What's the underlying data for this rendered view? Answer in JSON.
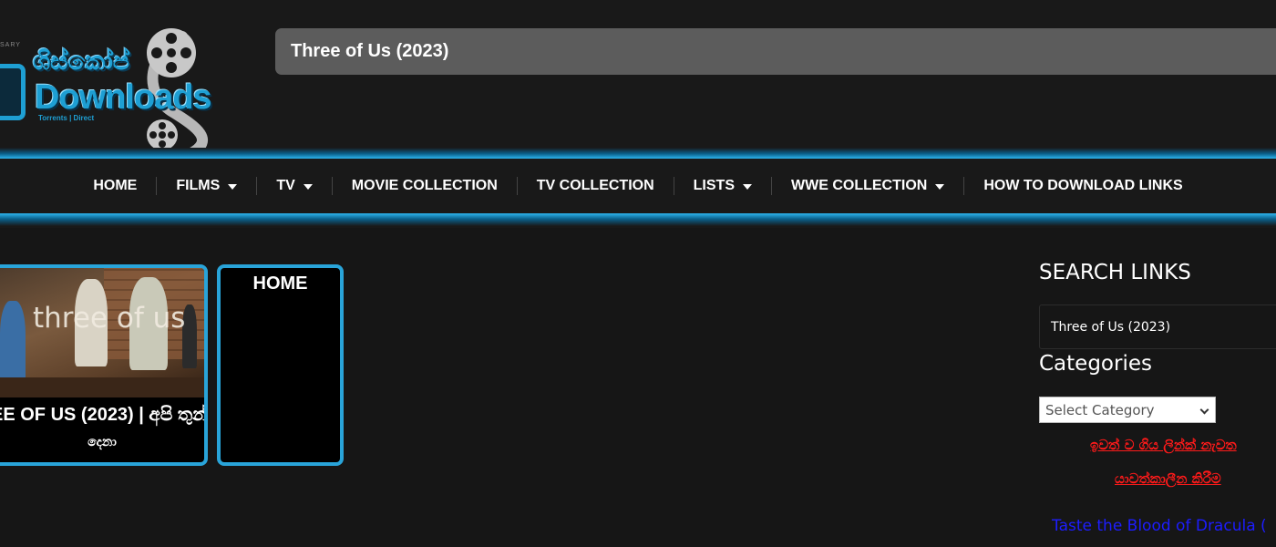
{
  "logo": {
    "sinhala_text": "ශිස්කෝප්",
    "downloads_text": "Downloads",
    "tagline_top": "SARY",
    "tagline_bottom": "Torrents | Direct"
  },
  "header": {
    "search_value": "Three of Us (2023)"
  },
  "nav": {
    "items": [
      {
        "label": "HOME",
        "dropdown": false
      },
      {
        "label": "FILMS",
        "dropdown": true
      },
      {
        "label": "TV",
        "dropdown": true
      },
      {
        "label": "MOVIE COLLECTION",
        "dropdown": false
      },
      {
        "label": "TV COLLECTION",
        "dropdown": false
      },
      {
        "label": "LISTS",
        "dropdown": true
      },
      {
        "label": "WWE COLLECTION",
        "dropdown": true
      },
      {
        "label": "HOW TO DOWNLOAD LINKS",
        "dropdown": false
      }
    ]
  },
  "content": {
    "movie_card": {
      "poster_title": "three of us",
      "caption": "EE OF US (2023) | අපි තුන්",
      "caption_sub": "දෙනා"
    },
    "home_card": {
      "label": "HOME"
    }
  },
  "sidebar": {
    "search_title": "SEARCH LINKS",
    "search_value": "Three of Us (2023)",
    "categories_title": "Categories",
    "category_selected": "Select Category",
    "red_link_1": "ඉවත් ව ගිය ලින්ක් නැවත",
    "red_link_2": "යාවත්කාලීන කිරීම",
    "blue_link": "Taste the Blood of Dracula ("
  },
  "colors": {
    "accent": "#29a4d9",
    "background": "#161616",
    "search_bg": "#5c5c5c",
    "red_link": "#ff1a1a",
    "blue_link": "#1d1dff"
  }
}
